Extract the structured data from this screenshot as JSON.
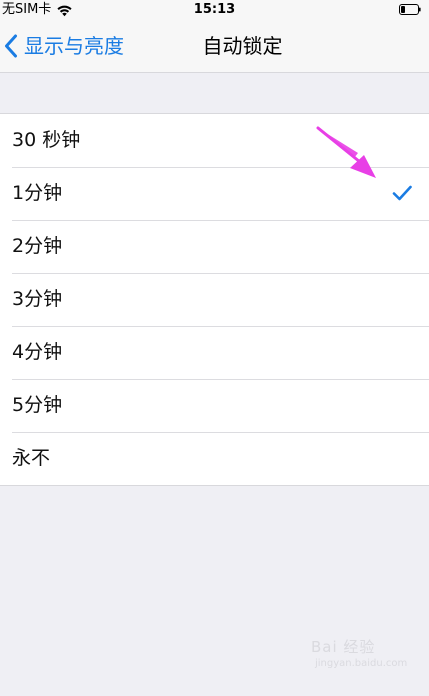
{
  "status_bar": {
    "carrier": "无SIM卡",
    "time": "15:13",
    "wifi_icon": "wifi-icon",
    "battery_icon": "battery-icon"
  },
  "nav": {
    "back_label": "显示与亮度",
    "title": "自动锁定",
    "back_icon": "chevron-left-icon"
  },
  "options": [
    {
      "label": "30 秒钟",
      "selected": false
    },
    {
      "label": "1分钟",
      "selected": true
    },
    {
      "label": "2分钟",
      "selected": false
    },
    {
      "label": "3分钟",
      "selected": false
    },
    {
      "label": "4分钟",
      "selected": false
    },
    {
      "label": "5分钟",
      "selected": false
    },
    {
      "label": "永不",
      "selected": false
    }
  ],
  "annotation": {
    "icon": "arrow-pointer-icon",
    "color": "#e83fe6"
  },
  "watermark": {
    "text": "Bai 经验",
    "sub": "jingyan.baidu.com"
  },
  "colors": {
    "accent": "#1a7ce3",
    "background": "#efeff4"
  }
}
